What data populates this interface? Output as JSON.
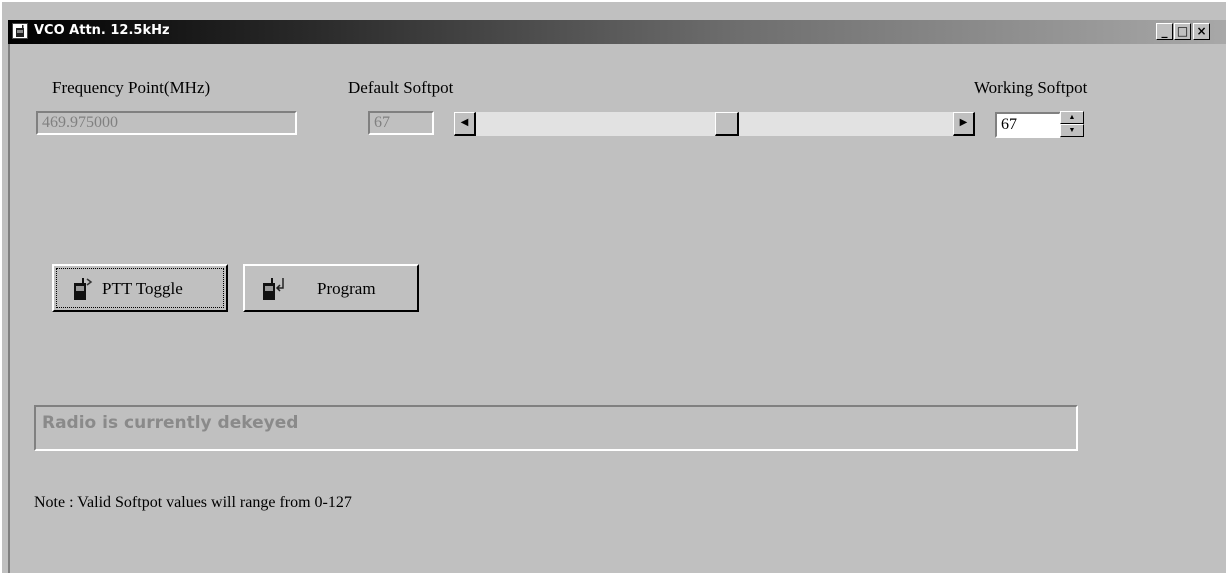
{
  "window": {
    "title": "VCO Attn. 12.5kHz",
    "minimize": "_",
    "maximize": "□",
    "close": "×"
  },
  "frequency": {
    "label": "Frequency Point(MHz)",
    "value": "469.975000"
  },
  "default_softpot": {
    "label": "Default Softpot",
    "value": "67"
  },
  "slider": {
    "min": 0,
    "max": 127,
    "value": 67,
    "left_arrow": "◀",
    "right_arrow": "▶"
  },
  "working_softpot": {
    "label": "Working Softpot",
    "value": "67",
    "up_arrow": "▲",
    "down_arrow": "▼"
  },
  "buttons": {
    "ptt_toggle": "PTT Toggle",
    "program": "Program"
  },
  "status": "Radio is currently dekeyed",
  "note": "Note : Valid Softpot values will range from 0-127",
  "icons": {
    "window": "radio-icon",
    "ptt": "radio-ptt-icon",
    "program": "radio-program-icon"
  }
}
